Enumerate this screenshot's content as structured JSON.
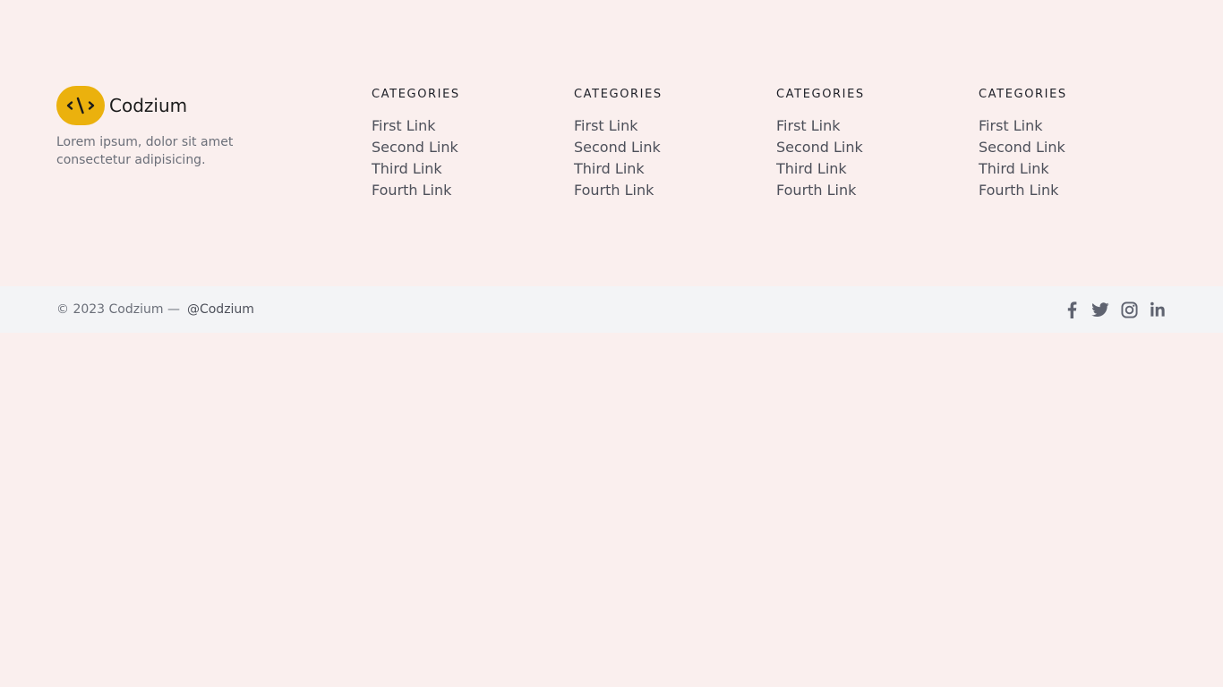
{
  "brand": {
    "name": "Codzium",
    "logo_icon": "code-brackets-icon",
    "logo_color": "#ebb10d",
    "description": "Lorem ipsum, dolor sit amet consectetur adipisicing."
  },
  "columns": [
    {
      "heading": "CATEGORIES",
      "links": [
        "First Link",
        "Second Link",
        "Third Link",
        "Fourth Link"
      ]
    },
    {
      "heading": "CATEGORIES",
      "links": [
        "First Link",
        "Second Link",
        "Third Link",
        "Fourth Link"
      ]
    },
    {
      "heading": "CATEGORIES",
      "links": [
        "First Link",
        "Second Link",
        "Third Link",
        "Fourth Link"
      ]
    },
    {
      "heading": "CATEGORIES",
      "links": [
        "First Link",
        "Second Link",
        "Third Link",
        "Fourth Link"
      ]
    }
  ],
  "bottom_bar": {
    "copyright": "© 2023 Codzium —",
    "handle": "@Codzium",
    "social_icons": [
      "facebook-icon",
      "twitter-icon",
      "instagram-icon",
      "linkedin-icon"
    ]
  },
  "colors": {
    "page_background": "#faefee",
    "bottom_bar_background": "#f3f4f6",
    "accent": "#ebb10d"
  }
}
